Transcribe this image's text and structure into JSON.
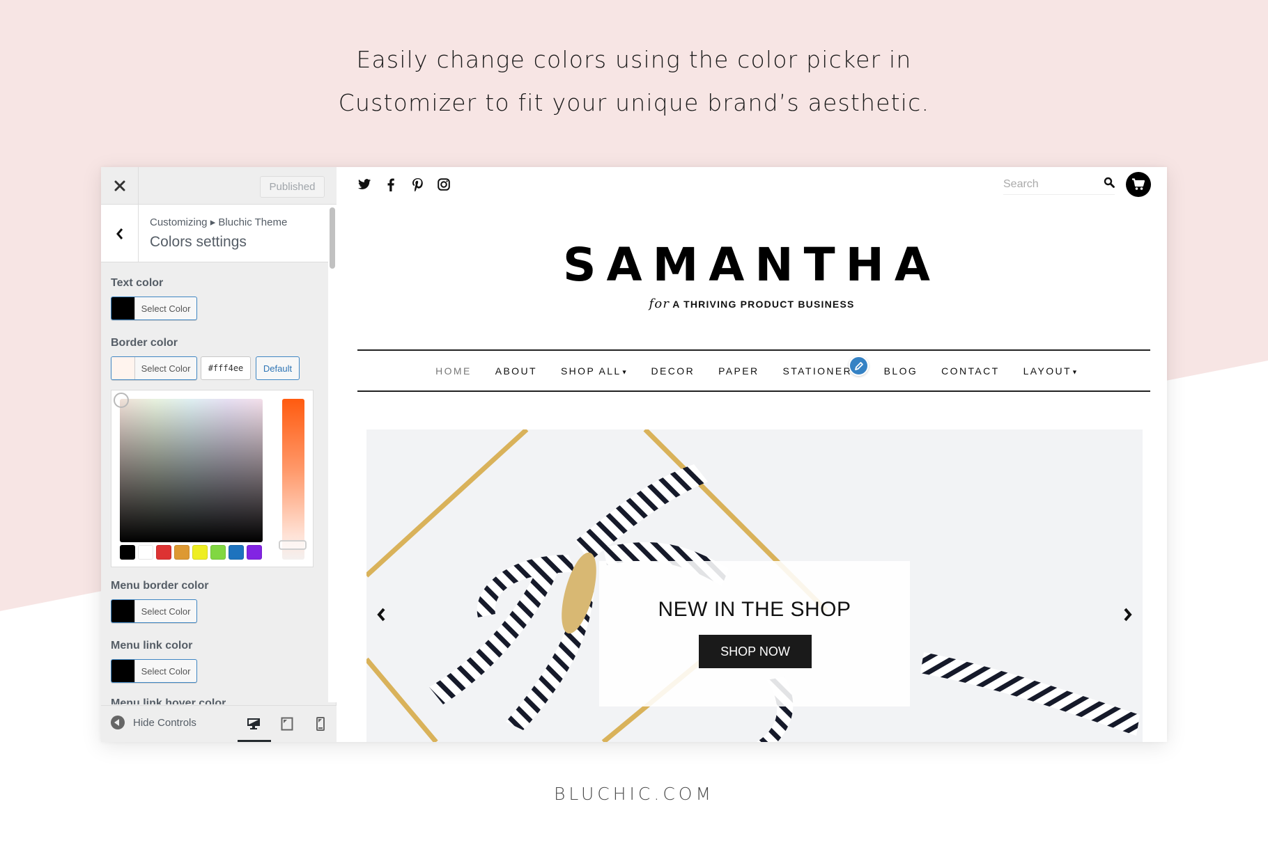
{
  "headline": {
    "line1": "Easily change colors using the color picker in",
    "line2": "Customizer to fit your unique brand’s aesthetic."
  },
  "colors": {
    "background_pink": "#f7e5e4",
    "accent_blue": "#3582c4"
  },
  "customizer": {
    "close_icon": "close-icon",
    "publish_label": "Published",
    "breadcrumb": "Customizing ▸ Bluchic Theme",
    "section_title": "Colors settings",
    "controls": [
      {
        "label": "Text color",
        "button_label": "Select Color",
        "swatch": "#000000"
      },
      {
        "label": "Border color",
        "button_label": "Select Color",
        "swatch": "#fff4ee",
        "hex_value": "#fff4ee",
        "default_label": "Default"
      },
      {
        "label": "Menu border color",
        "button_label": "Select Color",
        "swatch": "#000000"
      },
      {
        "label": "Menu link color",
        "button_label": "Select Color",
        "swatch": "#000000"
      },
      {
        "label": "Menu link hover color"
      }
    ],
    "palette": [
      "#000000",
      "#ffffff",
      "#dd3333",
      "#dd9933",
      "#eeee22",
      "#81d742",
      "#1e73be",
      "#8224e3"
    ],
    "footer": {
      "hide_controls_label": "Hide Controls",
      "devices": [
        "desktop",
        "tablet",
        "mobile"
      ],
      "active_device": "desktop"
    }
  },
  "site": {
    "social": [
      "twitter-icon",
      "facebook-icon",
      "pinterest-icon",
      "instagram-icon"
    ],
    "search_placeholder": "Search",
    "logo": "SAMANTHA",
    "tagline_script": "for",
    "tagline": "A THRIVING PRODUCT BUSINESS",
    "nav": [
      {
        "label": "HOME",
        "active": true
      },
      {
        "label": "ABOUT"
      },
      {
        "label": "SHOP ALL",
        "dropdown": true
      },
      {
        "label": "DECOR"
      },
      {
        "label": "PAPER"
      },
      {
        "label": "STATIONERY"
      },
      {
        "label": "BLOG"
      },
      {
        "label": "CONTACT"
      },
      {
        "label": "LAYOUT",
        "dropdown": true
      }
    ],
    "hero": {
      "title": "NEW IN THE SHOP",
      "button": "SHOP NOW"
    }
  },
  "footer_brand": "BLUCHIC.COM"
}
